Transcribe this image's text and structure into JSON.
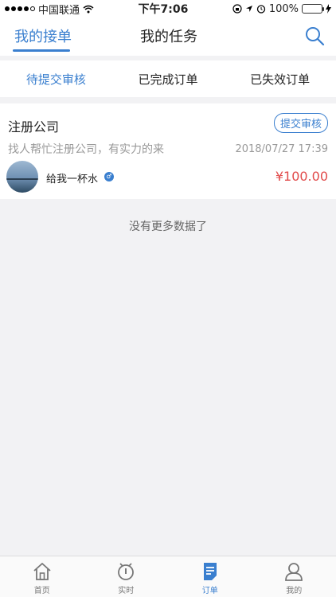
{
  "status_bar": {
    "carrier": "中国联通",
    "time": "下午7:06",
    "battery": "100%",
    "battery_level": 1.0
  },
  "header": {
    "tabs": [
      {
        "label": "我的接单",
        "active": true
      },
      {
        "label": "我的任务",
        "active": false
      }
    ],
    "search_icon": "search-icon"
  },
  "subtabs": [
    {
      "label": "待提交审核",
      "active": true
    },
    {
      "label": "已完成订单",
      "active": false
    },
    {
      "label": "已失效订单",
      "active": false
    }
  ],
  "order": {
    "title": "注册公司",
    "action_label": "提交审核",
    "description": "找人帮忙注册公司，有实力的来",
    "time": "2018/07/27 17:39",
    "user_name": "给我一杯水",
    "gender_icon": "male-icon",
    "price": "¥100.00"
  },
  "list_footer": "没有更多数据了",
  "tabbar": [
    {
      "label": "首页",
      "icon": "home-icon",
      "active": false
    },
    {
      "label": "实时",
      "icon": "realtime-icon",
      "active": false
    },
    {
      "label": "订单",
      "icon": "order-icon",
      "active": true
    },
    {
      "label": "我的",
      "icon": "profile-icon",
      "active": false
    }
  ],
  "colors": {
    "accent": "#3a7fcf",
    "price": "#e14b4b",
    "background": "#f2f2f4"
  }
}
